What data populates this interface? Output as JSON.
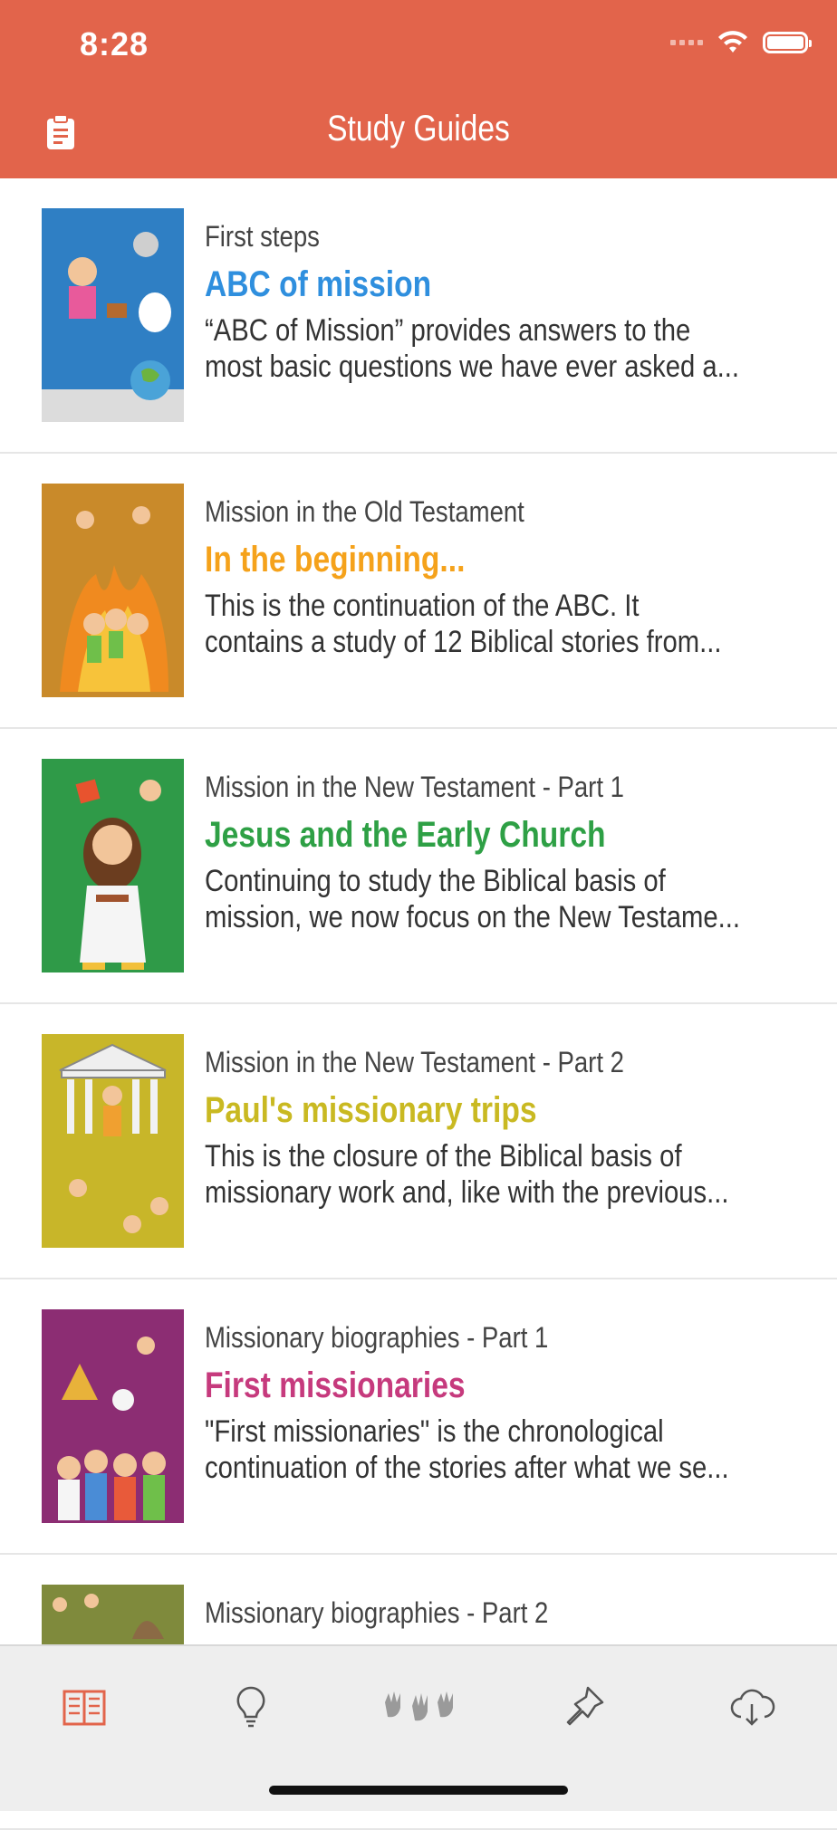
{
  "status_bar": {
    "time": "8:28"
  },
  "nav": {
    "title": "Study Guides",
    "left_icon": "clipboard-icon"
  },
  "colors": {
    "header": "#e2644b",
    "blue": "#2f8fde",
    "orange": "#f5a21b",
    "green": "#2ea045",
    "olive": "#c9b922",
    "magenta": "#c63a7d",
    "tab_active": "#e2644b",
    "tab_inactive": "#555555"
  },
  "guides": [
    {
      "subtitle": "First steps",
      "title": "ABC of mission",
      "desc1": "“ABC of Mission” provides answers to the",
      "desc2": "most basic questions we have ever asked a...",
      "color": "#2f8fde"
    },
    {
      "subtitle": "Mission in the Old Testament",
      "title": "In the beginning...",
      "desc1": "This is the continuation of the ABC. It",
      "desc2": "contains a study of 12 Biblical stories from...",
      "color": "#f5a21b"
    },
    {
      "subtitle": "Mission in the New Testament - Part 1",
      "title": "Jesus and the Early Church",
      "desc1": "Continuing to study the Biblical basis of",
      "desc2": "mission, we now focus on the New Testame...",
      "color": "#2ea045"
    },
    {
      "subtitle": "Mission in the New Testament - Part 2",
      "title": "Paul's missionary trips",
      "desc1": "This is the closure of the Biblical basis of",
      "desc2": "missionary work and, like with the previous...",
      "color": "#c9b922"
    },
    {
      "subtitle": "Missionary biographies - Part 1",
      "title": "First missionaries",
      "desc1": "\"First missionaries\" is the chronological",
      "desc2": "continuation of the stories after what we se...",
      "color": "#c63a7d"
    },
    {
      "subtitle": "Missionary biographies - Part 2",
      "title": "",
      "desc1": "",
      "desc2": "",
      "color": "#7a8a3a"
    }
  ],
  "tabs": [
    {
      "icon": "book-icon",
      "active": true
    },
    {
      "icon": "lightbulb-icon",
      "active": false
    },
    {
      "icon": "hands-icon",
      "active": false
    },
    {
      "icon": "pin-icon",
      "active": false
    },
    {
      "icon": "cloud-download-icon",
      "active": false
    }
  ]
}
